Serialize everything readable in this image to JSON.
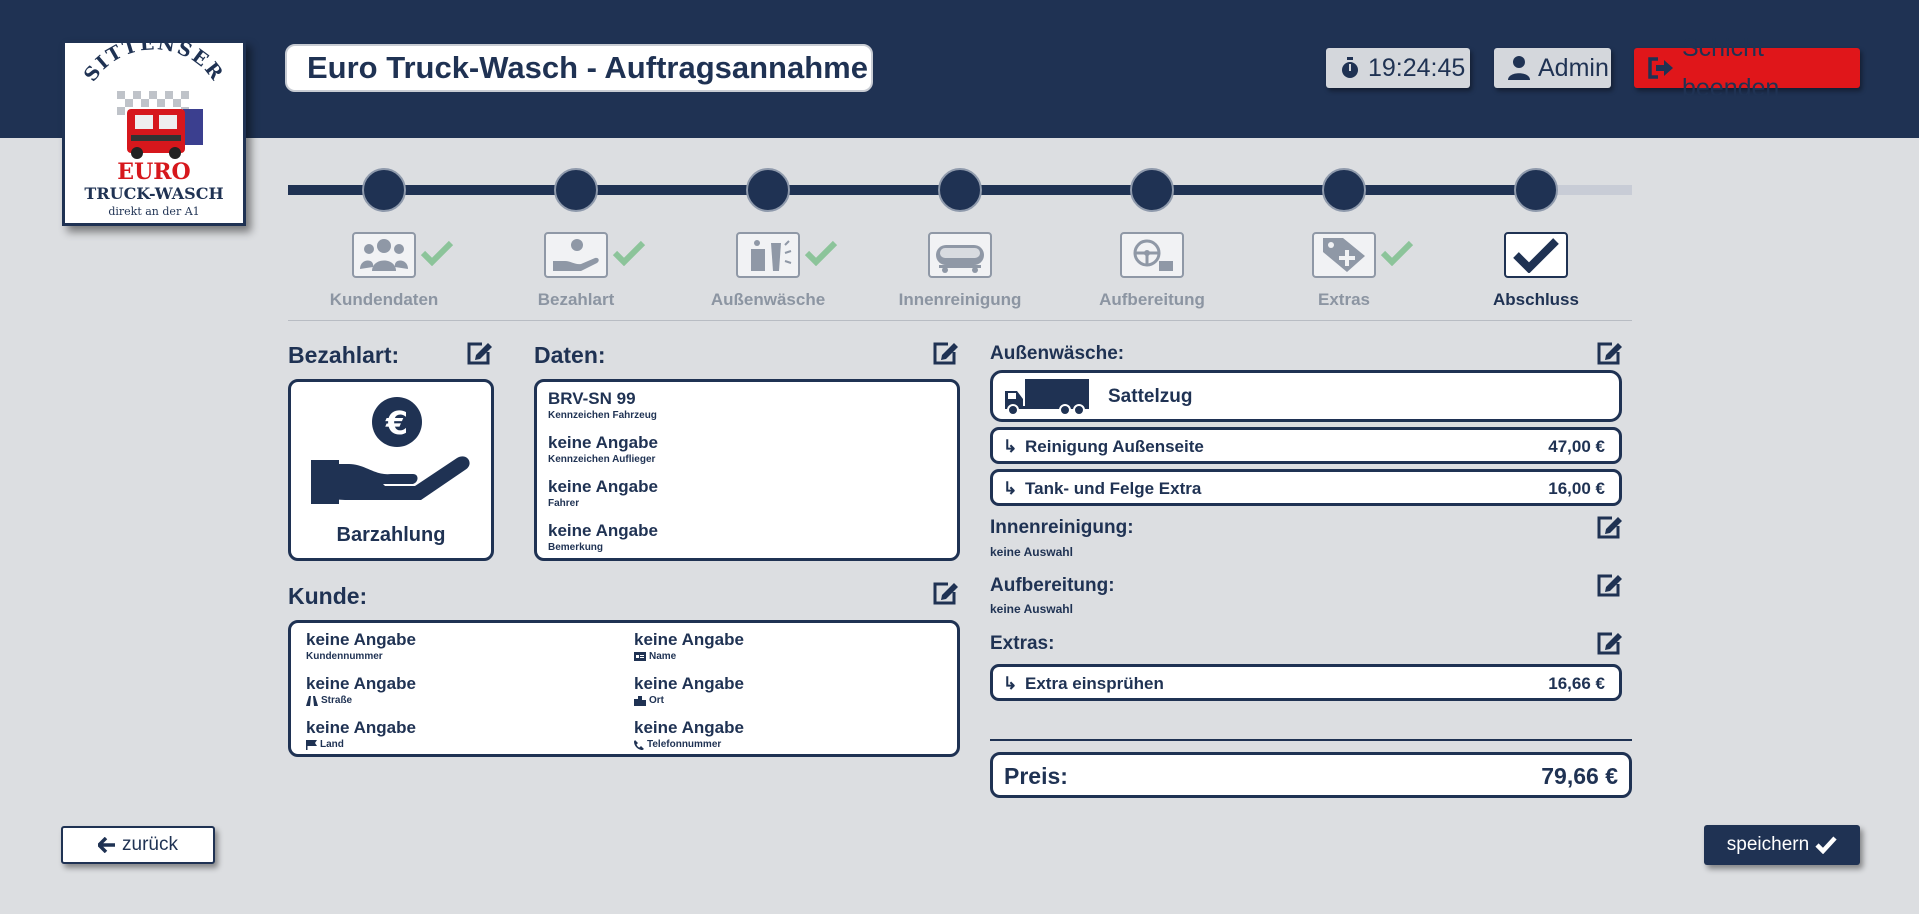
{
  "header": {
    "logo": {
      "line1": "SITTENSER",
      "line2": "EURO",
      "line3": "TRUCK-WASCH",
      "line4": "direkt an der A1"
    },
    "title": "Euro Truck-Wasch - Auftragsannahme",
    "clock": "19:24:45",
    "user": "Admin",
    "end_shift": "Schicht beenden",
    "colors": {
      "navy": "#1f3253",
      "danger": "#e0161a",
      "success": "#8cc49a"
    }
  },
  "steps": [
    {
      "label": "Kundendaten",
      "icon": "users-icon",
      "done": true
    },
    {
      "label": "Bezahlart",
      "icon": "hand-euro-icon",
      "done": true
    },
    {
      "label": "Außenwäsche",
      "icon": "exterior-wash-icon",
      "done": true
    },
    {
      "label": "Innenreinigung",
      "icon": "tank-icon",
      "done": false
    },
    {
      "label": "Aufbereitung",
      "icon": "steering-wheel-icon",
      "done": false
    },
    {
      "label": "Extras",
      "icon": "tag-plus-icon",
      "done": true
    },
    {
      "label": "Abschluss",
      "icon": "check-icon",
      "done": false,
      "active": true
    }
  ],
  "progress_fraction": 0.93,
  "payment": {
    "title": "Bezahlart:",
    "method": "Barzahlung"
  },
  "details": {
    "title": "Daten:",
    "rows": [
      {
        "value": "BRV-SN 99",
        "label": "Kennzeichen Fahrzeug"
      },
      {
        "value": "keine Angabe",
        "label": "Kennzeichen Auflieger"
      },
      {
        "value": "keine Angabe",
        "label": "Fahrer"
      },
      {
        "value": "keine Angabe",
        "label": "Bemerkung"
      }
    ]
  },
  "customer": {
    "title": "Kunde:",
    "fields": [
      {
        "value": "keine Angabe",
        "label": "Kundennummer",
        "icon": ""
      },
      {
        "value": "keine Angabe",
        "label": "Name",
        "icon": "id-card-icon"
      },
      {
        "value": "keine Angabe",
        "label": "Straße",
        "icon": "road-icon"
      },
      {
        "value": "keine Angabe",
        "label": "Ort",
        "icon": "city-icon"
      },
      {
        "value": "keine Angabe",
        "label": "Land",
        "icon": "flag-icon"
      },
      {
        "value": "keine Angabe",
        "label": "Telefonnummer",
        "icon": "phone-icon"
      }
    ]
  },
  "exterior": {
    "title": "Außenwäsche:",
    "vehicle": "Sattelzug",
    "items": [
      {
        "name": "Reinigung Außenseite",
        "price": "47,00 €"
      },
      {
        "name": "Tank- und Felge Extra",
        "price": "16,00 €"
      }
    ]
  },
  "interior": {
    "title": "Innenreinigung:",
    "value": "keine Auswahl"
  },
  "detailing": {
    "title": "Aufbereitung:",
    "value": "keine Auswahl"
  },
  "extras": {
    "title": "Extras:",
    "items": [
      {
        "name": "Extra einsprühen",
        "price": "16,66 €"
      }
    ]
  },
  "total": {
    "label": "Preis:",
    "value": "79,66 €"
  },
  "footer": {
    "back": "zurück",
    "save": "speichern"
  }
}
